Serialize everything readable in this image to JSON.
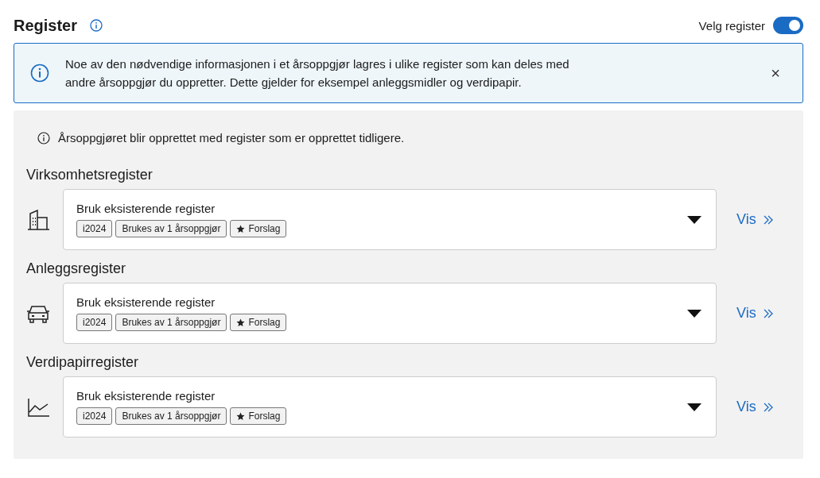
{
  "header": {
    "title": "Register",
    "toggle": {
      "label": "Velg register",
      "on": true
    }
  },
  "banner": {
    "text": "Noe av den nødvendige informasjonen i et årsoppgjør lagres i ulike register som kan deles med andre årsoppgjør du oppretter. Dette gjelder for eksempel anleggsmidler og verdipapir.",
    "close": "×"
  },
  "note": "Årsoppgjøret blir opprettet med register som er opprettet tidligere.",
  "registers": [
    {
      "title": "Virksomhetsregister",
      "kind": "building",
      "value": "Bruk eksisterende register",
      "tags": [
        {
          "text": "i2024",
          "starred": false
        },
        {
          "text": "Brukes av 1 årsoppgjør",
          "starred": false
        },
        {
          "text": "Forslag",
          "starred": true
        }
      ],
      "link": "Vis"
    },
    {
      "title": "Anleggsregister",
      "kind": "car",
      "value": "Bruk eksisterende register",
      "tags": [
        {
          "text": "i2024",
          "starred": false
        },
        {
          "text": "Brukes av 1 årsoppgjør",
          "starred": false
        },
        {
          "text": "Forslag",
          "starred": true
        }
      ],
      "link": "Vis"
    },
    {
      "title": "Verdipapirregister",
      "kind": "chart",
      "value": "Bruk eksisterende register",
      "tags": [
        {
          "text": "i2024",
          "starred": false
        },
        {
          "text": "Brukes av 1 årsoppgjør",
          "starred": false
        },
        {
          "text": "Forslag",
          "starred": true
        }
      ],
      "link": "Vis"
    }
  ]
}
